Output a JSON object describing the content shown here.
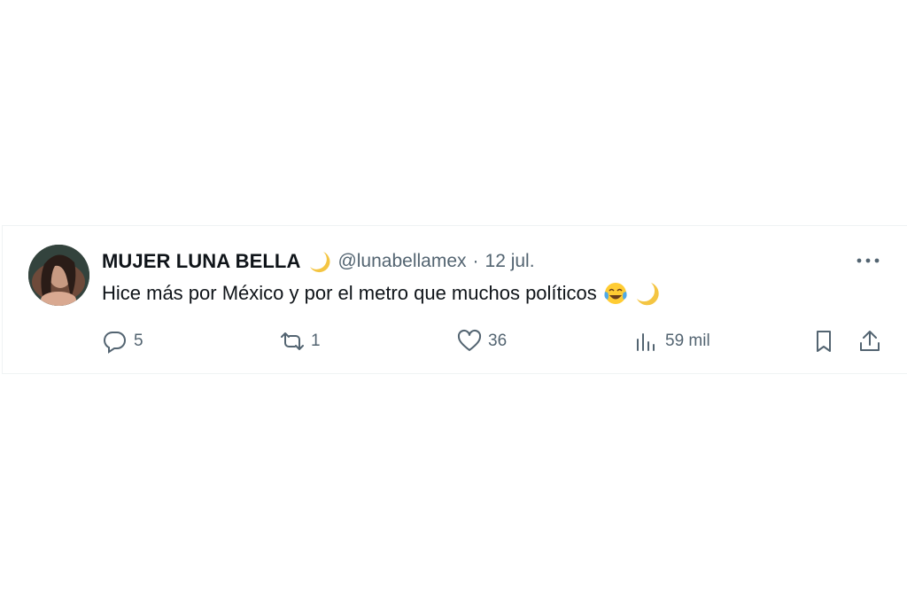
{
  "tweet": {
    "display_name": "MUJER LUNA BELLA",
    "handle": "@lunabellamex",
    "separator": "·",
    "date": "12 jul.",
    "text": "Hice más por México y por el metro que muchos políticos",
    "name_badge_icon": "crescent-moon-icon",
    "text_emojis": [
      "face-with-tears-of-joy-icon",
      "crescent-moon-icon"
    ]
  },
  "actions": {
    "replies": {
      "icon": "reply-icon",
      "count": "5"
    },
    "retweets": {
      "icon": "retweet-icon",
      "count": "1"
    },
    "likes": {
      "icon": "heart-icon",
      "count": "36"
    },
    "views": {
      "icon": "views-bar-chart-icon",
      "count": "59 mil"
    },
    "bookmark": {
      "icon": "bookmark-icon"
    },
    "share": {
      "icon": "share-icon"
    }
  },
  "colors": {
    "primary_text": "#0f1419",
    "secondary_text": "#536471",
    "border": "#eff3f4",
    "moon": "#f4c542"
  }
}
